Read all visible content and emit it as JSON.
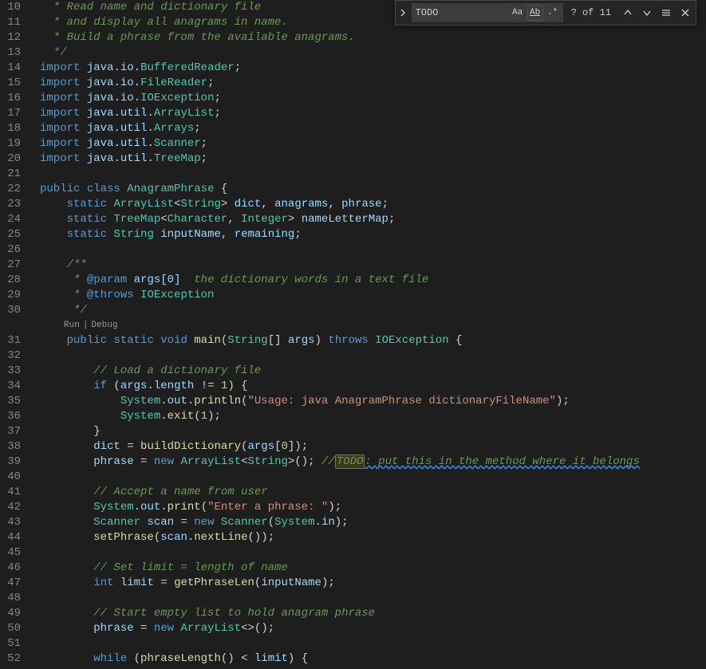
{
  "find": {
    "value": "TODO",
    "count": "? of 11"
  },
  "codelens": {
    "run": "Run",
    "debug": "Debug"
  },
  "lines": [
    {
      "n": 10,
      "seg": [
        [
          "cm",
          "  * Read name and dictionary file"
        ]
      ]
    },
    {
      "n": 11,
      "seg": [
        [
          "cm",
          "  * and display all anagrams in name."
        ]
      ]
    },
    {
      "n": 12,
      "seg": [
        [
          "cm",
          "  * Build a phrase from the available anagrams."
        ]
      ]
    },
    {
      "n": 13,
      "seg": [
        [
          "cm",
          "  */"
        ]
      ]
    },
    {
      "n": 14,
      "seg": [
        [
          "kw",
          "import"
        ],
        [
          "pn",
          " "
        ],
        [
          "id",
          "java"
        ],
        [
          "pn",
          "."
        ],
        [
          "id",
          "io"
        ],
        [
          "pn",
          "."
        ],
        [
          "cls",
          "BufferedReader"
        ],
        [
          "pn",
          ";"
        ]
      ]
    },
    {
      "n": 15,
      "seg": [
        [
          "kw",
          "import"
        ],
        [
          "pn",
          " "
        ],
        [
          "id",
          "java"
        ],
        [
          "pn",
          "."
        ],
        [
          "id",
          "io"
        ],
        [
          "pn",
          "."
        ],
        [
          "cls",
          "FileReader"
        ],
        [
          "pn",
          ";"
        ]
      ]
    },
    {
      "n": 16,
      "seg": [
        [
          "kw",
          "import"
        ],
        [
          "pn",
          " "
        ],
        [
          "id",
          "java"
        ],
        [
          "pn",
          "."
        ],
        [
          "id",
          "io"
        ],
        [
          "pn",
          "."
        ],
        [
          "cls",
          "IOException"
        ],
        [
          "pn",
          ";"
        ]
      ]
    },
    {
      "n": 17,
      "seg": [
        [
          "kw",
          "import"
        ],
        [
          "pn",
          " "
        ],
        [
          "id",
          "java"
        ],
        [
          "pn",
          "."
        ],
        [
          "id",
          "util"
        ],
        [
          "pn",
          "."
        ],
        [
          "cls",
          "ArrayList"
        ],
        [
          "pn",
          ";"
        ]
      ]
    },
    {
      "n": 18,
      "seg": [
        [
          "kw",
          "import"
        ],
        [
          "pn",
          " "
        ],
        [
          "id",
          "java"
        ],
        [
          "pn",
          "."
        ],
        [
          "id",
          "util"
        ],
        [
          "pn",
          "."
        ],
        [
          "cls",
          "Arrays"
        ],
        [
          "pn",
          ";"
        ]
      ]
    },
    {
      "n": 19,
      "seg": [
        [
          "kw",
          "import"
        ],
        [
          "pn",
          " "
        ],
        [
          "id",
          "java"
        ],
        [
          "pn",
          "."
        ],
        [
          "id",
          "util"
        ],
        [
          "pn",
          "."
        ],
        [
          "cls",
          "Scanner"
        ],
        [
          "pn",
          ";"
        ]
      ]
    },
    {
      "n": 20,
      "seg": [
        [
          "kw",
          "import"
        ],
        [
          "pn",
          " "
        ],
        [
          "id",
          "java"
        ],
        [
          "pn",
          "."
        ],
        [
          "id",
          "util"
        ],
        [
          "pn",
          "."
        ],
        [
          "cls",
          "TreeMap"
        ],
        [
          "pn",
          ";"
        ]
      ]
    },
    {
      "n": 21,
      "seg": []
    },
    {
      "n": 22,
      "seg": [
        [
          "kw",
          "public"
        ],
        [
          "pn",
          " "
        ],
        [
          "kw",
          "class"
        ],
        [
          "pn",
          " "
        ],
        [
          "cls",
          "AnagramPhrase"
        ],
        [
          "pn",
          " {"
        ]
      ]
    },
    {
      "n": 23,
      "seg": [
        [
          "pn",
          "    "
        ],
        [
          "kw",
          "static"
        ],
        [
          "pn",
          " "
        ],
        [
          "cls",
          "ArrayList"
        ],
        [
          "pn",
          "<"
        ],
        [
          "cls",
          "String"
        ],
        [
          "pn",
          "> "
        ],
        [
          "id",
          "dict"
        ],
        [
          "pn",
          ", "
        ],
        [
          "id",
          "anagrams"
        ],
        [
          "pn",
          ", "
        ],
        [
          "id",
          "phrase"
        ],
        [
          "pn",
          ";"
        ]
      ]
    },
    {
      "n": 24,
      "seg": [
        [
          "pn",
          "    "
        ],
        [
          "kw",
          "static"
        ],
        [
          "pn",
          " "
        ],
        [
          "cls",
          "TreeMap"
        ],
        [
          "pn",
          "<"
        ],
        [
          "cls",
          "Character"
        ],
        [
          "pn",
          ", "
        ],
        [
          "cls",
          "Integer"
        ],
        [
          "pn",
          "> "
        ],
        [
          "id",
          "nameLetterMap"
        ],
        [
          "pn",
          ";"
        ]
      ]
    },
    {
      "n": 25,
      "seg": [
        [
          "pn",
          "    "
        ],
        [
          "kw",
          "static"
        ],
        [
          "pn",
          " "
        ],
        [
          "cls",
          "String"
        ],
        [
          "pn",
          " "
        ],
        [
          "id",
          "inputName"
        ],
        [
          "pn",
          ", "
        ],
        [
          "id",
          "remaining"
        ],
        [
          "pn",
          ";"
        ]
      ]
    },
    {
      "n": 26,
      "seg": []
    },
    {
      "n": 27,
      "seg": [
        [
          "pn",
          "    "
        ],
        [
          "cm",
          "/**"
        ]
      ]
    },
    {
      "n": 28,
      "seg": [
        [
          "pn",
          "    "
        ],
        [
          "cm",
          " * "
        ],
        [
          "ann",
          "@param"
        ],
        [
          "cm",
          " "
        ],
        [
          "id",
          "args[0]"
        ],
        [
          "cm",
          "  the dictionary words in a text file"
        ]
      ]
    },
    {
      "n": 29,
      "seg": [
        [
          "pn",
          "    "
        ],
        [
          "cm",
          " * "
        ],
        [
          "ann",
          "@throws"
        ],
        [
          "cm",
          " "
        ],
        [
          "cls",
          "IOException"
        ]
      ]
    },
    {
      "n": 30,
      "seg": [
        [
          "pn",
          "    "
        ],
        [
          "cm",
          " */"
        ]
      ]
    },
    {
      "n": 31,
      "codelens": true,
      "seg": [
        [
          "pn",
          "    "
        ],
        [
          "kw",
          "public"
        ],
        [
          "pn",
          " "
        ],
        [
          "kw",
          "static"
        ],
        [
          "pn",
          " "
        ],
        [
          "kw",
          "void"
        ],
        [
          "pn",
          " "
        ],
        [
          "fn",
          "main"
        ],
        [
          "pn",
          "("
        ],
        [
          "cls",
          "String"
        ],
        [
          "pn",
          "[] "
        ],
        [
          "id",
          "args"
        ],
        [
          "pn",
          ") "
        ],
        [
          "kw",
          "throws"
        ],
        [
          "pn",
          " "
        ],
        [
          "cls",
          "IOException"
        ],
        [
          "pn",
          " {"
        ]
      ]
    },
    {
      "n": 32,
      "seg": []
    },
    {
      "n": 33,
      "seg": [
        [
          "pn",
          "        "
        ],
        [
          "cm",
          "// Load a dictionary file"
        ]
      ]
    },
    {
      "n": 34,
      "seg": [
        [
          "pn",
          "        "
        ],
        [
          "kw",
          "if"
        ],
        [
          "pn",
          " ("
        ],
        [
          "id",
          "args"
        ],
        [
          "pn",
          "."
        ],
        [
          "id",
          "length"
        ],
        [
          "pn",
          " "
        ],
        [
          "op",
          "!="
        ],
        [
          "pn",
          " "
        ],
        [
          "num",
          "1"
        ],
        [
          "pn",
          ") {"
        ]
      ]
    },
    {
      "n": 35,
      "seg": [
        [
          "pn",
          "            "
        ],
        [
          "cls",
          "System"
        ],
        [
          "pn",
          "."
        ],
        [
          "id",
          "out"
        ],
        [
          "pn",
          "."
        ],
        [
          "fn",
          "println"
        ],
        [
          "pn",
          "("
        ],
        [
          "str",
          "\"Usage: java AnagramPhrase dictionaryFileName\""
        ],
        [
          "pn",
          ");"
        ]
      ]
    },
    {
      "n": 36,
      "seg": [
        [
          "pn",
          "            "
        ],
        [
          "cls",
          "System"
        ],
        [
          "pn",
          "."
        ],
        [
          "fn",
          "exit"
        ],
        [
          "pn",
          "("
        ],
        [
          "num",
          "1"
        ],
        [
          "pn",
          ");"
        ]
      ]
    },
    {
      "n": 37,
      "seg": [
        [
          "pn",
          "        }"
        ]
      ]
    },
    {
      "n": 38,
      "seg": [
        [
          "pn",
          "        "
        ],
        [
          "id",
          "dict"
        ],
        [
          "pn",
          " = "
        ],
        [
          "fn",
          "buildDictionary"
        ],
        [
          "pn",
          "("
        ],
        [
          "id",
          "args"
        ],
        [
          "pn",
          "["
        ],
        [
          "num",
          "0"
        ],
        [
          "pn",
          "]);"
        ]
      ]
    },
    {
      "n": 39,
      "seg": [
        [
          "pn",
          "        "
        ],
        [
          "id",
          "phrase"
        ],
        [
          "pn",
          " = "
        ],
        [
          "kw",
          "new"
        ],
        [
          "pn",
          " "
        ],
        [
          "cls",
          "ArrayList"
        ],
        [
          "pn",
          "<"
        ],
        [
          "cls",
          "String"
        ],
        [
          "pn",
          ">(); "
        ],
        [
          "cm",
          "//"
        ],
        [
          "hl",
          "TODO"
        ],
        [
          "sq",
          ": put this in the method where it belongs"
        ]
      ]
    },
    {
      "n": 40,
      "seg": []
    },
    {
      "n": 41,
      "seg": [
        [
          "pn",
          "        "
        ],
        [
          "cm",
          "// Accept a name from user"
        ]
      ]
    },
    {
      "n": 42,
      "seg": [
        [
          "pn",
          "        "
        ],
        [
          "cls",
          "System"
        ],
        [
          "pn",
          "."
        ],
        [
          "id",
          "out"
        ],
        [
          "pn",
          "."
        ],
        [
          "fn",
          "print"
        ],
        [
          "pn",
          "("
        ],
        [
          "str",
          "\"Enter a phrase: \""
        ],
        [
          "pn",
          ");"
        ]
      ]
    },
    {
      "n": 43,
      "seg": [
        [
          "pn",
          "        "
        ],
        [
          "cls",
          "Scanner"
        ],
        [
          "pn",
          " "
        ],
        [
          "id",
          "scan"
        ],
        [
          "pn",
          " = "
        ],
        [
          "kw",
          "new"
        ],
        [
          "pn",
          " "
        ],
        [
          "cls",
          "Scanner"
        ],
        [
          "pn",
          "("
        ],
        [
          "cls",
          "System"
        ],
        [
          "pn",
          "."
        ],
        [
          "id",
          "in"
        ],
        [
          "pn",
          ");"
        ]
      ]
    },
    {
      "n": 44,
      "seg": [
        [
          "pn",
          "        "
        ],
        [
          "fn",
          "setPhrase"
        ],
        [
          "pn",
          "("
        ],
        [
          "id",
          "scan"
        ],
        [
          "pn",
          "."
        ],
        [
          "fn",
          "nextLine"
        ],
        [
          "pn",
          "());"
        ]
      ]
    },
    {
      "n": 45,
      "seg": []
    },
    {
      "n": 46,
      "seg": [
        [
          "pn",
          "        "
        ],
        [
          "cm",
          "// Set limit = length of name"
        ]
      ]
    },
    {
      "n": 47,
      "seg": [
        [
          "pn",
          "        "
        ],
        [
          "kw",
          "int"
        ],
        [
          "pn",
          " "
        ],
        [
          "id",
          "limit"
        ],
        [
          "pn",
          " = "
        ],
        [
          "fn",
          "getPhraseLen"
        ],
        [
          "pn",
          "("
        ],
        [
          "id",
          "inputName"
        ],
        [
          "pn",
          ");"
        ]
      ]
    },
    {
      "n": 48,
      "seg": []
    },
    {
      "n": 49,
      "seg": [
        [
          "pn",
          "        "
        ],
        [
          "cm",
          "// Start empty list to hold anagram phrase"
        ]
      ]
    },
    {
      "n": 50,
      "seg": [
        [
          "pn",
          "        "
        ],
        [
          "id",
          "phrase"
        ],
        [
          "pn",
          " = "
        ],
        [
          "kw",
          "new"
        ],
        [
          "pn",
          " "
        ],
        [
          "cls",
          "ArrayList"
        ],
        [
          "pn",
          "<>();"
        ]
      ]
    },
    {
      "n": 51,
      "seg": []
    },
    {
      "n": 52,
      "seg": [
        [
          "pn",
          "        "
        ],
        [
          "kw",
          "while"
        ],
        [
          "pn",
          " ("
        ],
        [
          "fn",
          "phraseLength"
        ],
        [
          "pn",
          "() "
        ],
        [
          "op",
          "<"
        ],
        [
          "pn",
          " "
        ],
        [
          "id",
          "limit"
        ],
        [
          "pn",
          ") {"
        ]
      ]
    }
  ]
}
